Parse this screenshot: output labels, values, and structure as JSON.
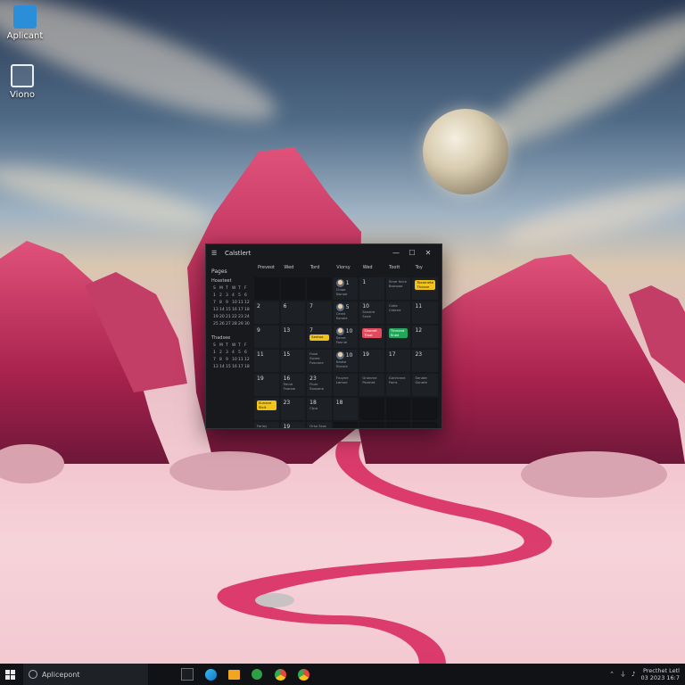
{
  "desktop": {
    "icons": [
      {
        "name": "Aplicant",
        "icon": "document-icon"
      },
      {
        "name": "Viono",
        "icon": "picture-icon"
      }
    ]
  },
  "window": {
    "title": "Calstlert",
    "controls": {
      "minimize": "—",
      "maximize": "☐",
      "close": "✕"
    },
    "sidebar": {
      "pages_label": "Pages",
      "mini_calendars": [
        {
          "month": "Hoasteet",
          "weekdays": [
            "S",
            "M",
            "T",
            "W",
            "T",
            "F"
          ],
          "days": [
            "1",
            "2",
            "3",
            "4",
            "5",
            "6",
            "7",
            "8",
            "9",
            "10",
            "11",
            "12",
            "13",
            "14",
            "15",
            "16",
            "17",
            "18",
            "19",
            "20",
            "21",
            "22",
            "23",
            "24",
            "25",
            "26",
            "27",
            "28",
            "29",
            "30"
          ]
        },
        {
          "month": "Thadsee",
          "weekdays": [
            "S",
            "M",
            "T",
            "W",
            "T",
            "F"
          ],
          "days": [
            "1",
            "2",
            "3",
            "4",
            "5",
            "6",
            "7",
            "8",
            "9",
            "10",
            "11",
            "12",
            "13",
            "14",
            "15",
            "16",
            "17",
            "18"
          ]
        }
      ]
    },
    "day_headers": [
      "Preveot",
      "Wed",
      "Tord",
      "Viorsy",
      "Wed",
      "Toott",
      "Toy"
    ],
    "weeks": [
      [
        {
          "num": "",
          "dark": true
        },
        {
          "num": "",
          "dark": true
        },
        {
          "num": "",
          "dark": true
        },
        {
          "num": "1",
          "avatar": true,
          "sub": "Cinoe Swnoe"
        },
        {
          "num": "1",
          "sub": ""
        },
        {
          "num": "",
          "sub": "Sime fnice Bamooe"
        },
        {
          "num": "",
          "event": {
            "text": "Toxarnete Thesee",
            "color": "yellow"
          }
        }
      ],
      [
        {
          "num": "2"
        },
        {
          "num": "6"
        },
        {
          "num": "7"
        },
        {
          "num": "5",
          "avatar": true,
          "sub": "Cerat Sonole"
        },
        {
          "num": "10",
          "sub": "Ssnoire Snoe"
        },
        {
          "num": "",
          "sub": "Cotie Catene"
        },
        {
          "num": "11"
        }
      ],
      [
        {
          "num": "9"
        },
        {
          "num": "13"
        },
        {
          "num": "7",
          "event": {
            "text": "Sentoa",
            "color": "yellow"
          }
        },
        {
          "num": "10",
          "avatar": true,
          "sub": "Serve Fannie"
        },
        {
          "num": "",
          "event": {
            "text": "Sinonet Tinat",
            "color": "red"
          }
        },
        {
          "num": "",
          "event": {
            "text": "Tinmeot Snee",
            "color": "green"
          }
        },
        {
          "num": "12"
        }
      ],
      [
        {
          "num": "11"
        },
        {
          "num": "15"
        },
        {
          "num": "",
          "sub": "Fooe Ssnee Foscone"
        },
        {
          "num": "10",
          "avatar": true,
          "sub": "Nirote Sionne"
        },
        {
          "num": "19"
        },
        {
          "num": "17"
        },
        {
          "num": "23"
        }
      ],
      [
        {
          "num": "19"
        },
        {
          "num": "16",
          "sub": "Sinne Fsanoe"
        },
        {
          "num": "23",
          "sub": "Fiuar Ssosone"
        },
        {
          "num": "",
          "sub": "Fnoyne Lamoe"
        },
        {
          "num": "",
          "sub": "Gnanme Psomat"
        },
        {
          "num": "",
          "sub": "Gonhrane Fanis"
        },
        {
          "num": "",
          "sub": "Senate Gsnate"
        }
      ],
      [
        {
          "num": "",
          "event": {
            "text": "Sunane Stcit",
            "color": "yellow"
          }
        },
        {
          "num": "23"
        },
        {
          "num": "18",
          "sub": "Ctpo"
        },
        {
          "num": "18"
        },
        {
          "num": "",
          "dark": true
        },
        {
          "num": "",
          "dark": true
        },
        {
          "num": "",
          "dark": true
        }
      ],
      [
        {
          "num": "",
          "sub": "Farloy Posoe"
        },
        {
          "num": "19",
          "sub": "Snas Treooe"
        },
        {
          "num": "",
          "sub": "Orso Ssos"
        },
        {
          "num": "",
          "dark": true
        },
        {
          "num": "",
          "dark": true
        },
        {
          "num": "",
          "dark": true
        },
        {
          "num": "",
          "dark": true
        }
      ]
    ]
  },
  "taskbar": {
    "search_placeholder": "Aplicepont",
    "apps": [
      "task-view-icon",
      "edge-icon",
      "files-icon",
      "xbox-icon",
      "chrome-icon",
      "chrome-icon"
    ],
    "clock": {
      "line1": "Precthet  Letl",
      "line2": "03 2023  16:7"
    }
  },
  "colors": {
    "yellow": "#f2c318",
    "red": "#e24b5d",
    "green": "#1fa85a",
    "window_bg": "#17191d"
  }
}
